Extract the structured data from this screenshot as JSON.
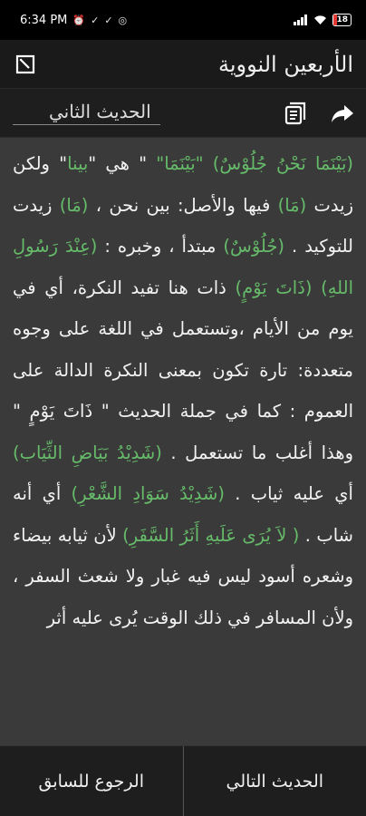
{
  "status": {
    "time": "6:34 PM",
    "battery": "18",
    "battery_level": 0.18,
    "icons": [
      "alarm-icon",
      "check-icon",
      "check-icon",
      "whatsapp-icon",
      "signal-icon",
      "wifi-icon"
    ]
  },
  "header": {
    "app_title": "الأربعين النووية",
    "sub_title": "الحديث الثاني"
  },
  "content": {
    "segments": [
      {
        "text": "(بَيْنَمَا نَحْنُ جُلُوْسٌ) \"بَيْنَمَا\"",
        "hl": true
      },
      {
        "text": " \" هي \"",
        "hl": false
      },
      {
        "text": "بينا",
        "hl": true
      },
      {
        "text": "\" ولكن زيدت ",
        "hl": false
      },
      {
        "text": "(مَا)",
        "hl": true
      },
      {
        "text": " فيها والأصل: بين نحن ، ",
        "hl": false
      },
      {
        "text": "(مَا)",
        "hl": true
      },
      {
        "text": " زيدت للتوكيد . ",
        "hl": false
      },
      {
        "text": "(جُلُوْسٌ)",
        "hl": true
      },
      {
        "text": " مبتدأ ، وخبره : ",
        "hl": false
      },
      {
        "text": "(عِنْدَ رَسُولِ اللهِ) (ذَاتَ يَوْمٍ)",
        "hl": true
      },
      {
        "text": " ذات هنا تفيد النكرة، أي في يوم من الأيام ،وتستعمل في اللغة على وجوه متعددة: تارة تكون بمعنى النكرة الدالة على العموم : كما في جملة الحديث \" ذَاتَ يَوْمٍ \" وهذا أغلب ما تستعمل . ",
        "hl": false
      },
      {
        "text": "(شَدِيْدُ بَيَاضِ الثِّيَاب)",
        "hl": true
      },
      {
        "text": " أي عليه ثياب . ",
        "hl": false
      },
      {
        "text": "(شَدِيْدُ سَوَادِ الشَّعْرِ)",
        "hl": true
      },
      {
        "text": " أي أنه شاب . ",
        "hl": false
      },
      {
        "text": "( لاَ يُرَى عَلَيهِ أَثَرُ السَّفَرِ)",
        "hl": true
      },
      {
        "text": " لأن ثيابه بيضاء وشعره أسود ليس فيه غبار ولا شعث السفر ، ولأن المسافر في ذلك الوقت يُرى عليه أثر",
        "hl": false
      }
    ]
  },
  "bottom": {
    "next_label": "الحديث التالي",
    "prev_label": "الرجوع للسابق"
  }
}
